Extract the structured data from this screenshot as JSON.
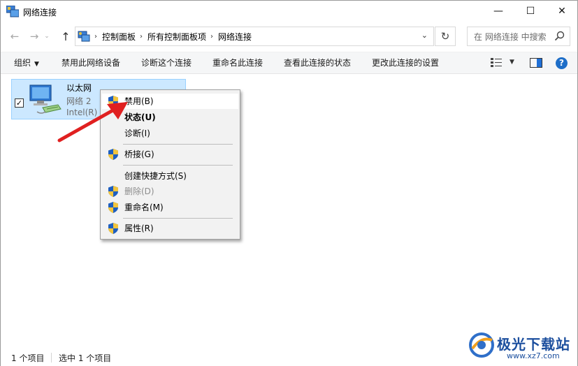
{
  "window": {
    "title": "网络连接",
    "min_glyph": "—",
    "max_glyph": "☐",
    "close_glyph": "✕"
  },
  "nav": {
    "back_glyph": "←",
    "forward_glyph": "→",
    "recent_glyph": "⌄",
    "up_glyph": "↑",
    "breadcrumbs": [
      "控制面板",
      "所有控制面板项",
      "网络连接"
    ],
    "crumb_sep": "›",
    "dropdown_glyph": "⌄",
    "refresh_glyph": "↻",
    "search_placeholder": "在 网络连接 中搜索"
  },
  "commands": {
    "organize": "组织",
    "organize_caret": "▼",
    "disable_device": "禁用此网络设备",
    "diagnose": "诊断这个连接",
    "rename": "重命名此连接",
    "view_status": "查看此连接的状态",
    "change_settings": "更改此连接的设置",
    "view_caret": "▼",
    "help_glyph": "?"
  },
  "network_item": {
    "checked_glyph": "✓",
    "name": "以太网",
    "subtitle": "网络 2",
    "adapter": "Intel(R) E"
  },
  "context_menu": {
    "items": [
      {
        "label": "禁用(B)"
      },
      {
        "label": "状态(U)"
      },
      {
        "label": "诊断(I)"
      },
      {
        "label": "桥接(G)"
      },
      {
        "label": "创建快捷方式(S)"
      },
      {
        "label": "删除(D)"
      },
      {
        "label": "重命名(M)"
      },
      {
        "label": "属性(R)"
      }
    ]
  },
  "status_bar": {
    "item_count": "1 个项目",
    "selected_count": "选中 1 个项目"
  },
  "watermark": {
    "title": "极光下载站",
    "url": "www.xz7.com"
  },
  "colors": {
    "selection_bg": "#cce8ff",
    "accent_blue": "#1e6ec8",
    "arrow_red": "#e02020",
    "watermark_blue": "#1c4f9e"
  }
}
